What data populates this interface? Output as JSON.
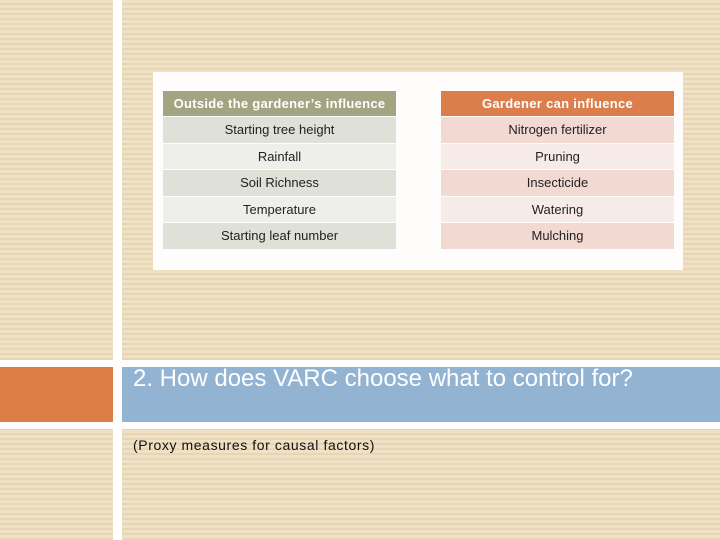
{
  "slide": {
    "title": "2. How does VARC choose what to control for?",
    "subtitle": "(Proxy measures for causal factors)"
  },
  "tables": {
    "outside": {
      "header": "Outside the gardener’s influence",
      "rows": [
        "Starting tree height",
        "Rainfall",
        "Soil Richness",
        "Temperature",
        "Starting leaf number"
      ]
    },
    "inside": {
      "header": "Gardener can influence",
      "rows": [
        "Nitrogen fertilizer",
        "Pruning",
        "Insecticide",
        "Watering",
        "Mulching"
      ]
    }
  },
  "colors": {
    "accent_orange": "#dc7d45",
    "title_blue": "#93b3d2",
    "outside_header": "#a3a582",
    "inside_header": "#db7e4b"
  }
}
